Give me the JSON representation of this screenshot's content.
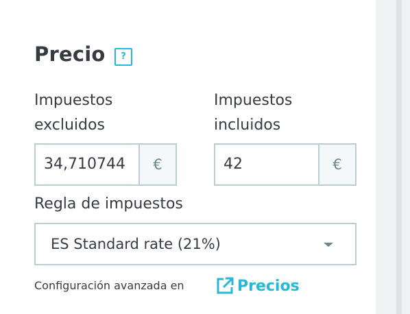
{
  "section": {
    "title": "Precio",
    "help_icon": "help-icon",
    "help_text": "?"
  },
  "price_tax_excluded": {
    "label_line1": "Impuestos",
    "label_line2": "excluidos",
    "value": "34,710744",
    "currency": "€"
  },
  "price_tax_included": {
    "label_line1": "Impuestos",
    "label_line2": "incluidos",
    "value": "42",
    "currency": "€"
  },
  "tax_rule": {
    "label": "Regla de impuestos",
    "selected": "ES Standard rate (21%)",
    "icon": "chevron-down-icon"
  },
  "footer": {
    "text": "Configuración avanzada en",
    "link_label": "Precios",
    "link_icon": "external-link-icon"
  },
  "colors": {
    "accent": "#25b9d7",
    "text": "#363a41",
    "border": "#bbcdd2",
    "addon_bg": "#f5f8f9",
    "gutter": "#eff1f2"
  }
}
